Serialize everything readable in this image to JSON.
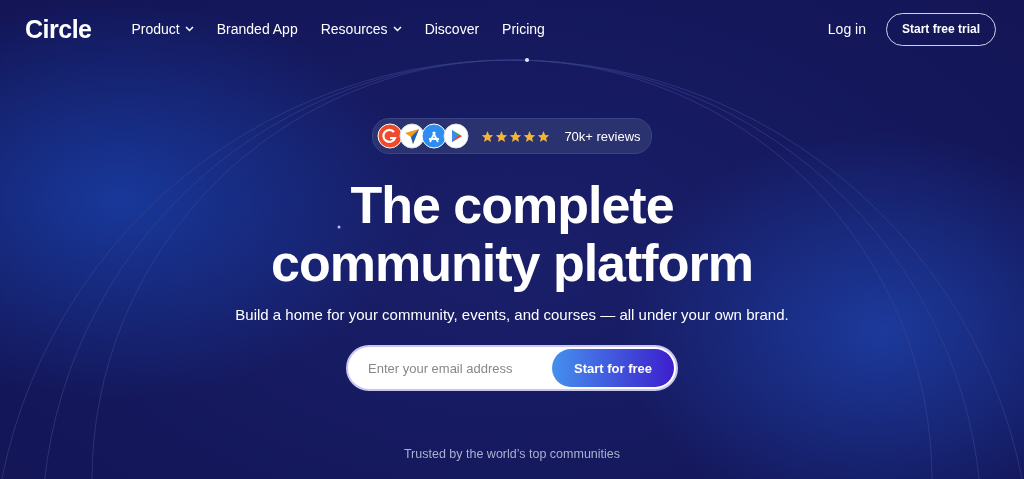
{
  "header": {
    "logo": "Circle",
    "nav": [
      {
        "label": "Product",
        "dropdown": true
      },
      {
        "label": "Branded App",
        "dropdown": false
      },
      {
        "label": "Resources",
        "dropdown": true
      },
      {
        "label": "Discover",
        "dropdown": false
      },
      {
        "label": "Pricing",
        "dropdown": false
      }
    ],
    "login": "Log in",
    "cta": "Start free trial"
  },
  "hero": {
    "reviews": {
      "stars": 5,
      "text": "70k+ reviews"
    },
    "title_lines": [
      "The complete",
      "community platform"
    ],
    "subtitle": "Build a home for your community, events, and courses — all under your own brand.",
    "signup": {
      "placeholder": "Enter your email address",
      "button": "Start for free"
    },
    "trusted": "Trusted by the world’s top communities"
  }
}
